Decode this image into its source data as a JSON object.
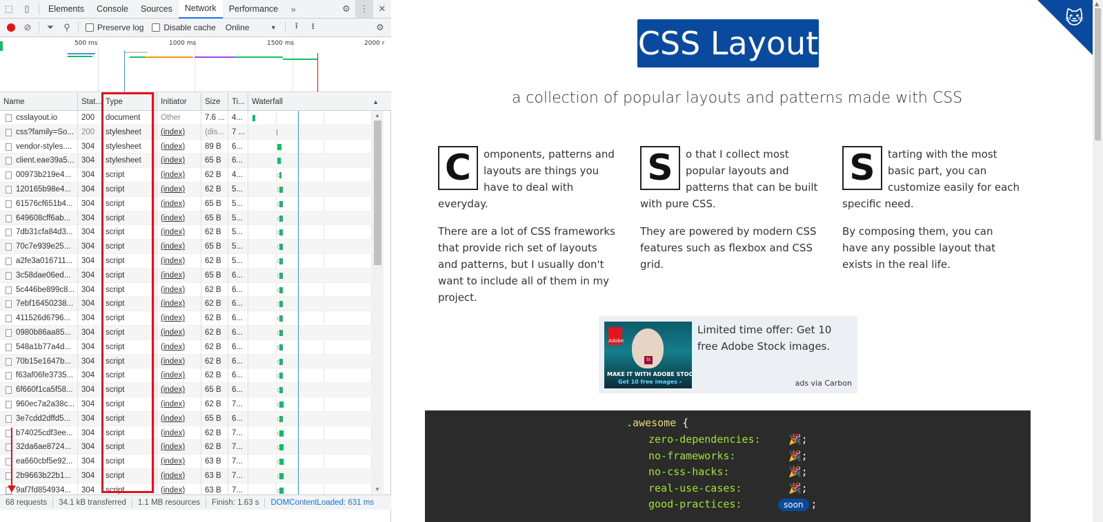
{
  "devtools": {
    "tabs": [
      "Elements",
      "Console",
      "Sources",
      "Network",
      "Performance"
    ],
    "active_tab": "Network",
    "more_tabs_icon": "chevron-double-right-icon",
    "toolbar": {
      "preserve_log": "Preserve log",
      "disable_cache": "Disable cache",
      "throttle": "Online"
    },
    "overview": {
      "ticks": [
        "500 ms",
        "1000 ms",
        "1500 ms",
        "2000 r"
      ]
    },
    "columns": [
      "Name",
      "Stat...",
      "Type",
      "Initiator",
      "Size",
      "Ti...",
      "Waterfall"
    ],
    "requests": [
      {
        "name": "csslayout.io",
        "status": "200",
        "type": "document",
        "initiator": "Other",
        "size": "7.6 ...",
        "time": "4..."
      },
      {
        "name": "css?family=So...",
        "status": "200",
        "type": "stylesheet",
        "initiator": "(index)",
        "size": "(dis...",
        "time": "7 ..."
      },
      {
        "name": "vendor-styles....",
        "status": "304",
        "type": "stylesheet",
        "initiator": "(index)",
        "size": "89 B",
        "time": "6..."
      },
      {
        "name": "client.eae39a5...",
        "status": "304",
        "type": "stylesheet",
        "initiator": "(index)",
        "size": "65 B",
        "time": "6..."
      },
      {
        "name": "00973b219e4...",
        "status": "304",
        "type": "script",
        "initiator": "(index)",
        "size": "62 B",
        "time": "4..."
      },
      {
        "name": "120165b98e4...",
        "status": "304",
        "type": "script",
        "initiator": "(index)",
        "size": "62 B",
        "time": "5..."
      },
      {
        "name": "61576cf651b4...",
        "status": "304",
        "type": "script",
        "initiator": "(index)",
        "size": "65 B",
        "time": "5..."
      },
      {
        "name": "649608cff6ab...",
        "status": "304",
        "type": "script",
        "initiator": "(index)",
        "size": "65 B",
        "time": "5..."
      },
      {
        "name": "7db31cfa84d3...",
        "status": "304",
        "type": "script",
        "initiator": "(index)",
        "size": "62 B",
        "time": "5..."
      },
      {
        "name": "70c7e939e25...",
        "status": "304",
        "type": "script",
        "initiator": "(index)",
        "size": "65 B",
        "time": "5..."
      },
      {
        "name": "a2fe3a016711...",
        "status": "304",
        "type": "script",
        "initiator": "(index)",
        "size": "62 B",
        "time": "5..."
      },
      {
        "name": "3c58dae06ed...",
        "status": "304",
        "type": "script",
        "initiator": "(index)",
        "size": "65 B",
        "time": "6..."
      },
      {
        "name": "5c446be899c8...",
        "status": "304",
        "type": "script",
        "initiator": "(index)",
        "size": "62 B",
        "time": "6..."
      },
      {
        "name": "7ebf16450238...",
        "status": "304",
        "type": "script",
        "initiator": "(index)",
        "size": "62 B",
        "time": "6..."
      },
      {
        "name": "411526d6796...",
        "status": "304",
        "type": "script",
        "initiator": "(index)",
        "size": "62 B",
        "time": "6..."
      },
      {
        "name": "0980b86aa85...",
        "status": "304",
        "type": "script",
        "initiator": "(index)",
        "size": "62 B",
        "time": "6..."
      },
      {
        "name": "548a1b77a4d...",
        "status": "304",
        "type": "script",
        "initiator": "(index)",
        "size": "62 B",
        "time": "6..."
      },
      {
        "name": "70b15e1647b...",
        "status": "304",
        "type": "script",
        "initiator": "(index)",
        "size": "62 B",
        "time": "6..."
      },
      {
        "name": "f63af06fe3735...",
        "status": "304",
        "type": "script",
        "initiator": "(index)",
        "size": "62 B",
        "time": "6..."
      },
      {
        "name": "6f660f1ca5f58...",
        "status": "304",
        "type": "script",
        "initiator": "(index)",
        "size": "65 B",
        "time": "6..."
      },
      {
        "name": "960ec7a2a38c...",
        "status": "304",
        "type": "script",
        "initiator": "(index)",
        "size": "62 B",
        "time": "7..."
      },
      {
        "name": "3e7cdd2dffd5...",
        "status": "304",
        "type": "script",
        "initiator": "(index)",
        "size": "65 B",
        "time": "6..."
      },
      {
        "name": "b74025cdf3ee...",
        "status": "304",
        "type": "script",
        "initiator": "(index)",
        "size": "62 B",
        "time": "7..."
      },
      {
        "name": "32da6ae8724...",
        "status": "304",
        "type": "script",
        "initiator": "(index)",
        "size": "62 B",
        "time": "7..."
      },
      {
        "name": "ea660cbf5e92...",
        "status": "304",
        "type": "script",
        "initiator": "(index)",
        "size": "63 B",
        "time": "7..."
      },
      {
        "name": "2b9663b22b1...",
        "status": "304",
        "type": "script",
        "initiator": "(index)",
        "size": "63 B",
        "time": "7..."
      },
      {
        "name": "9af7fd854934...",
        "status": "304",
        "type": "script",
        "initiator": "(index)",
        "size": "63 B",
        "time": "7..."
      }
    ],
    "status_bar": {
      "requests": "68 requests",
      "transferred": "34.1 kB transferred",
      "resources": "1.1 MB resources",
      "finish": "Finish: 1.63 s",
      "dcl": "DOMContentLoaded: 631 ms"
    }
  },
  "page": {
    "logo": "CSS Layout",
    "tagline": "a collection of popular layouts and patterns made with CSS",
    "columns": [
      {
        "dropcap": "C",
        "p1": "omponents, patterns and layouts are things you have to deal with everyday.",
        "p2": "There are a lot of CSS frameworks that provide rich set of layouts and patterns, but I usually don't want to include all of them in my project."
      },
      {
        "dropcap": "S",
        "p1": "o that I collect most popular layouts and patterns that can be built with pure CSS.",
        "p2": "They are powered by modern CSS features such as flexbox and CSS grid."
      },
      {
        "dropcap": "S",
        "p1": "tarting with the most basic part, you can customize easily for each specific need.",
        "p2": "By composing them, you can have any possible layout that exists in the real life."
      }
    ],
    "ad": {
      "brand": "Adobe",
      "badge": "St",
      "image_line1": "MAKE IT WITH ADOBE STOCK.",
      "image_line2": "Get 10 free images ›",
      "text": "Limited time offer: Get 10 free Adobe Stock images.",
      "via": "ads via Carbon"
    },
    "code": {
      "selector": ".awesome",
      "open_brace": "{",
      "lines": [
        {
          "prop": "zero-dependencies:",
          "val": "🎉;"
        },
        {
          "prop": "no-frameworks:",
          "val": "🎉;"
        },
        {
          "prop": "no-css-hacks:",
          "val": "🎉;"
        },
        {
          "prop": "real-use-cases:",
          "val": "🎉;"
        },
        {
          "prop": "good-practices:",
          "val": ";",
          "badge": "soon"
        }
      ]
    }
  },
  "colors": {
    "brand": "#0a4a9e",
    "highlight": "#e5101a",
    "waterfall": "#0fbd62",
    "active_tab": "#1a73e8"
  }
}
